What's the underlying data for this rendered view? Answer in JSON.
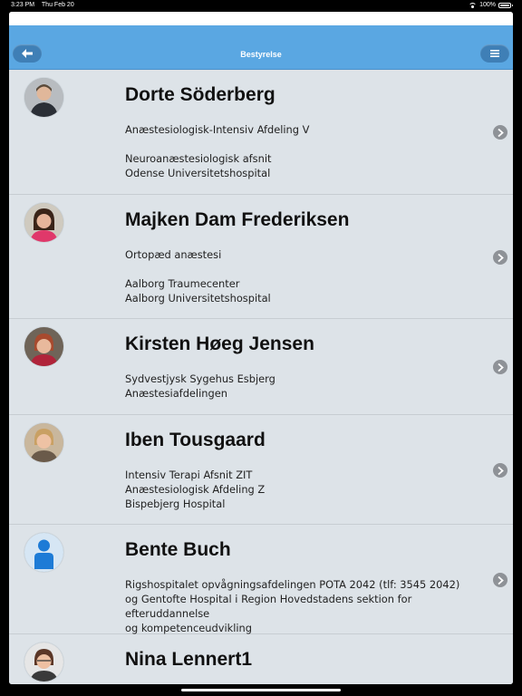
{
  "status_bar": {
    "time": "3:23 PM",
    "date": "Thu Feb 20",
    "battery": "100%"
  },
  "navbar": {
    "title": "Bestyrelse",
    "back_icon": "arrow-left-icon",
    "menu_icon": "hamburger-menu-icon"
  },
  "members": [
    {
      "name": "Dorte Söderberg",
      "lines": [
        "Anæstesiologisk-Intensiv Afdeling V",
        "",
        "Neuroanæstesiologisk afsnit",
        "Odense Universitetshospital"
      ]
    },
    {
      "name": "Majken Dam Frederiksen",
      "lines": [
        "Ortopæd anæstesi",
        "",
        "Aalborg Traumecenter",
        "Aalborg Universitetshospital"
      ]
    },
    {
      "name": "Kirsten Høeg Jensen",
      "lines": [
        "Sydvestjysk Sygehus Esbjerg",
        "Anæstesiafdelingen"
      ]
    },
    {
      "name": "Iben Tousgaard",
      "lines": [
        "Intensiv Terapi Afsnit ZIT",
        "Anæstesiologisk Afdeling Z",
        "Bispebjerg Hospital"
      ]
    },
    {
      "name": "Bente Buch",
      "lines": [
        "Rigshospitalet opvågningsafdelingen POTA 2042 (tlf: 3545 2042)",
        "og Gentofte Hospital i Region Hovedstadens sektion for efteruddannelse",
        "og kompetenceudvikling"
      ]
    },
    {
      "name": "Nina Lennert1",
      "lines": []
    }
  ]
}
